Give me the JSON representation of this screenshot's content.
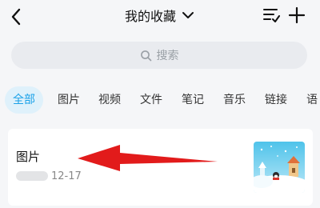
{
  "header": {
    "title": "我的收藏",
    "back_icon": "chevron-left-icon",
    "dropdown_icon": "chevron-down-icon",
    "sort_icon": "sort-list-icon",
    "add_icon": "plus-icon"
  },
  "search": {
    "placeholder": "搜索",
    "icon": "search-icon"
  },
  "tabs": [
    {
      "label": "全部",
      "active": true
    },
    {
      "label": "图片",
      "active": false
    },
    {
      "label": "视频",
      "active": false
    },
    {
      "label": "文件",
      "active": false
    },
    {
      "label": "笔记",
      "active": false
    },
    {
      "label": "音乐",
      "active": false
    },
    {
      "label": "链接",
      "active": false
    },
    {
      "label": "语",
      "active": false
    }
  ],
  "items": [
    {
      "title": "图片",
      "date": "12-17",
      "thumbnail": "snow-scene-image"
    }
  ],
  "annotation": {
    "icon": "red-arrow-left-icon",
    "color": "#e21b1b"
  },
  "colors": {
    "accent": "#1aa1e8",
    "accent_bg": "#dff1fb",
    "background": "#f5f6f8"
  }
}
